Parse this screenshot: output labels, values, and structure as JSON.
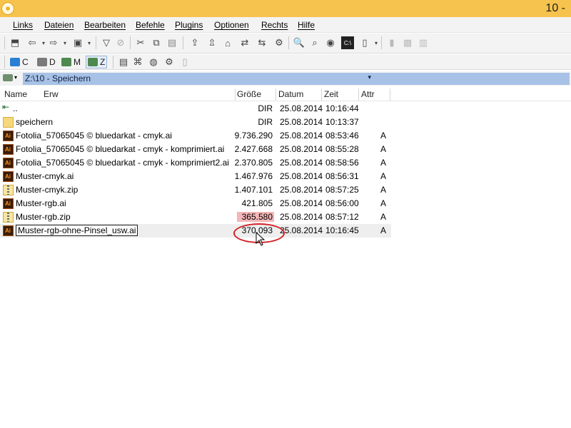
{
  "window": {
    "title": "10 -"
  },
  "menu": [
    "Links",
    "Dateien",
    "Bearbeiten",
    "Befehle",
    "Plugins",
    "Optionen",
    "Rechts",
    "Hilfe"
  ],
  "drives": [
    {
      "label": "C",
      "color": "#2a7fd4"
    },
    {
      "label": "D",
      "color": "#7a7a7a"
    },
    {
      "label": "M",
      "color": "#4e8a4e"
    },
    {
      "label": "Z",
      "color": "#4e8a4e"
    }
  ],
  "path": "Z:\\10 - Speichern",
  "columns": {
    "name": "Name",
    "ext": "Erw",
    "size": "Größe",
    "date": "Datum",
    "time": "Zeit",
    "attr": "Attr"
  },
  "files": [
    {
      "icon": "up",
      "name": "..",
      "size": "DIR",
      "date": "25.08.2014",
      "time": "10:16:44",
      "attr": ""
    },
    {
      "icon": "folder",
      "name": "speichern",
      "size": "DIR",
      "date": "25.08.2014",
      "time": "10:13:37",
      "attr": ""
    },
    {
      "icon": "ai",
      "name": "Fotolia_57065045 © bluedarkat - cmyk.ai",
      "size": "9.736.290",
      "date": "25.08.2014",
      "time": "08:53:46",
      "attr": "A"
    },
    {
      "icon": "ai",
      "name": "Fotolia_57065045 © bluedarkat - cmyk - komprimiert.ai",
      "size": "2.427.668",
      "date": "25.08.2014",
      "time": "08:55:28",
      "attr": "A"
    },
    {
      "icon": "ai",
      "name": "Fotolia_57065045 © bluedarkat - cmyk - komprimiert2.ai",
      "size": "2.370.805",
      "date": "25.08.2014",
      "time": "08:58:56",
      "attr": "A"
    },
    {
      "icon": "ai",
      "name": "Muster-cmyk.ai",
      "size": "1.467.976",
      "date": "25.08.2014",
      "time": "08:56:31",
      "attr": "A"
    },
    {
      "icon": "zip",
      "name": "Muster-cmyk.zip",
      "size": "1.407.101",
      "date": "25.08.2014",
      "time": "08:57:25",
      "attr": "A"
    },
    {
      "icon": "ai",
      "name": "Muster-rgb.ai",
      "size": "421.805",
      "date": "25.08.2014",
      "time": "08:56:00",
      "attr": "A"
    },
    {
      "icon": "zip",
      "name": "Muster-rgb.zip",
      "size": "365.580",
      "date": "25.08.2014",
      "time": "08:57:12",
      "attr": "A",
      "highlight": "#f4b6b8"
    },
    {
      "icon": "ai",
      "name": "Muster-rgb-ohne-Pinsel_usw.ai",
      "size": "370.093",
      "date": "25.08.2014",
      "time": "10:16:45",
      "attr": "A",
      "selected": true
    }
  ]
}
